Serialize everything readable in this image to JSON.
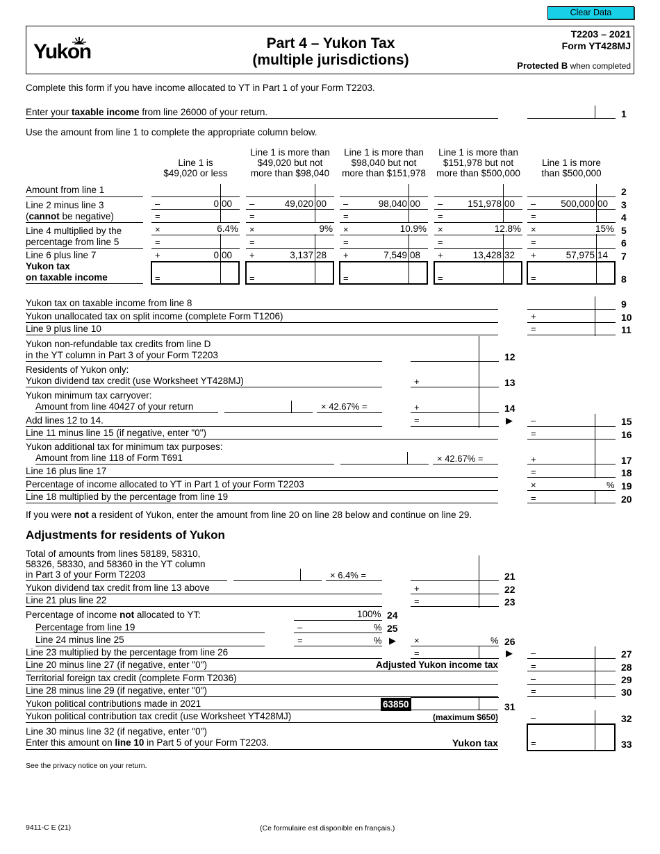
{
  "toolbar": {
    "clear_data_label": "Clear Data"
  },
  "header": {
    "logo_text": "Yukon",
    "title_line1": "Part 4 – Yukon Tax",
    "title_line2": "(multiple jurisdictions)",
    "form_number": "T2203 – 2021",
    "form_name": "Form YT428MJ",
    "protected_bold": "Protected B",
    "protected_rest": " when completed"
  },
  "intro": "Complete this form if you have income allocated to YT in Part 1 of your Form T2203.",
  "line1": {
    "pre": "Enter your ",
    "bold": "taxable income",
    "post": " from line 26000 of your return.",
    "num": "1",
    "value": ""
  },
  "instruction": "Use the amount from line 1 to complete the appropriate column below.",
  "columns": [
    {
      "head1": "",
      "head2": "Line 1 is",
      "head3": "$49,020 or less",
      "line3": "0",
      "line3c": "00",
      "rate": "6.4%",
      "line7": "0",
      "line7c": "00"
    },
    {
      "head1": "Line 1 is more than",
      "head2": "$49,020 but not",
      "head3": "more than $98,040",
      "line3": "49,020",
      "line3c": "00",
      "rate": "9%",
      "line7": "3,137",
      "line7c": "28"
    },
    {
      "head1": "Line 1 is more than",
      "head2": "$98,040 but not",
      "head3": "more than $151,978",
      "line3": "98,040",
      "line3c": "00",
      "rate": "10.9%",
      "line7": "7,549",
      "line7c": "08"
    },
    {
      "head1": "Line 1 is more than",
      "head2": "$151,978 but not",
      "head3": "more than $500,000",
      "line3": "151,978",
      "line3c": "00",
      "rate": "12.8%",
      "line7": "13,428",
      "line7c": "32"
    },
    {
      "head1": "",
      "head2": "Line 1 is more",
      "head3": "than $500,000",
      "line3": "500,000",
      "line3c": "00",
      "rate": "15%",
      "line7": "57,975",
      "line7c": "14"
    }
  ],
  "table_rows": {
    "r2": "Amount from line 1",
    "r3": "Line 2 minus line 3",
    "r4_pre": "(",
    "r4_bold": "cannot",
    "r4_post": " be negative)",
    "r5": "Line 4 multiplied by the",
    "r6": "percentage from line 5",
    "r7": "Line 6 plus line 7",
    "r8a": "Yukon tax",
    "r8b": "on taxable income"
  },
  "symbols": {
    "minus": "–",
    "equals": "=",
    "times": "×",
    "plus": "+",
    "percent": "%",
    "arrow": "▶"
  },
  "lines": {
    "l9": "Yukon tax on taxable income from line 8",
    "l10": "Yukon unallocated tax on split income (complete Form T1206)",
    "l11": "Line 9 plus line 10",
    "l12a": "Yukon non-refundable tax credits from line D",
    "l12b": "in the YT column in Part 3 of your Form T2203",
    "l13a": "Residents of Yukon only:",
    "l13b": "Yukon dividend tax credit (use Worksheet YT428MJ)",
    "l14a": "Yukon minimum tax carryover:",
    "l14b": "Amount from line 40427 of your return",
    "l14rate": "× 42.67% =",
    "l15": "Add lines 12 to 14.",
    "l16": "Line 11 minus line 15 (if negative, enter \"0\")",
    "l17a": "Yukon additional tax for minimum tax purposes:",
    "l17b": "Amount from line 118 of Form T691",
    "l17rate": "× 42.67% =",
    "l18": "Line 16 plus line 17",
    "l19": "Percentage of income allocated to YT in Part 1 of your Form T2203",
    "l20": "Line 18 multiplied by the percentage from line 19"
  },
  "nonresident_note": {
    "pre": "If you were ",
    "bold": "not",
    "post": " a resident of Yukon, enter the amount from line 20 on line 28 below and continue on line 29."
  },
  "adjustments": {
    "heading": "Adjustments for residents of Yukon",
    "l21a": "Total of amounts from lines 58189, 58310,",
    "l21b": "58326, 58330, and 58360 in the YT column",
    "l21c": "in Part 3 of your Form T2203",
    "l21rate": "× 6.4% =",
    "l22": "Yukon dividend tax credit from line 13 above",
    "l23": "Line 21 plus line 22",
    "l24_pre": "Percentage of income ",
    "l24_bold": "not",
    "l24_post": " allocated to YT:",
    "l24value": "100%",
    "l25": "Percentage from line 19",
    "l26": "Line 24 minus line 25",
    "l27": "Line 23 multiplied by the percentage from line 26",
    "l28": "Line 20 minus line 27 (if negative, enter \"0\")",
    "l28label": "Adjusted Yukon income tax",
    "l29": "Territorial foreign tax credit (complete Form T2036)",
    "l30": "Line 28 minus line 29 (if negative, enter \"0\")",
    "l31": "Yukon political contributions made in 2021",
    "l31code": "63850",
    "l32": "Yukon political contribution tax credit (use Worksheet YT428MJ)",
    "l32max": "(maximum $650)",
    "l33a": "Line 30 minus line 32 (if negative, enter \"0\")",
    "l33b_pre": "Enter this amount on ",
    "l33b_bold": "line 10",
    "l33b_post": " in Part 5 of your Form T2203.",
    "l33label": "Yukon tax"
  },
  "line_numbers": [
    "1",
    "2",
    "3",
    "4",
    "5",
    "6",
    "7",
    "8",
    "9",
    "10",
    "11",
    "12",
    "13",
    "14",
    "15",
    "16",
    "17",
    "18",
    "19",
    "20",
    "21",
    "22",
    "23",
    "24",
    "25",
    "26",
    "27",
    "28",
    "29",
    "30",
    "31",
    "32",
    "33"
  ],
  "privacy": "See the privacy notice on your return.",
  "footer": {
    "code": "9411-C E (21)",
    "french": "(Ce formulaire est disponible en français.)"
  }
}
